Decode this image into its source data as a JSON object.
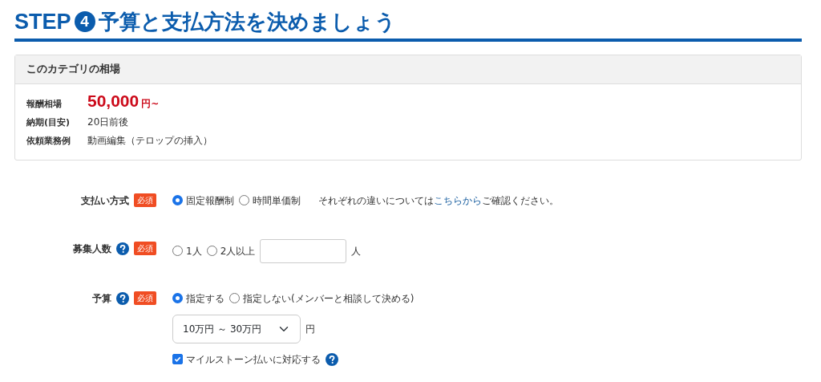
{
  "heading": {
    "prefix": "STEP",
    "step_number": "4",
    "title": "予算と支払方法を決めましょう"
  },
  "market": {
    "title": "このカテゴリの相場",
    "rows": [
      {
        "kind": "price",
        "label": "報酬相場",
        "value": "50,000",
        "unit": "円~"
      },
      {
        "kind": "text",
        "label": "納期(目安)",
        "value": "20日前後"
      },
      {
        "kind": "text",
        "label": "依頼業務例",
        "value": "動画編集（テロップの挿入）"
      }
    ]
  },
  "form": [
    {
      "label": "支払い方式",
      "help": false,
      "required": "必須",
      "radios": [
        {
          "label": "固定報酬制",
          "selected": true
        },
        {
          "label": "時間単価制",
          "selected": false
        }
      ],
      "note": {
        "before": "それぞれの違いについては",
        "link": "こちらから",
        "after": "ご確認ください。"
      }
    },
    {
      "label": "募集人数",
      "help": true,
      "required": "必須",
      "radios": [
        {
          "label": "1人",
          "selected": false
        },
        {
          "label": "2人以上",
          "selected": false
        }
      ],
      "input": {
        "unit": "人"
      }
    },
    {
      "label": "予算",
      "help": true,
      "required": "必須",
      "radios": [
        {
          "label": "指定する",
          "selected": true
        },
        {
          "label": "指定しない(メンバーと相談して決める)",
          "selected": false
        }
      ],
      "select": {
        "value": "10万円 ～ 30万円",
        "unit": "円"
      },
      "checkbox": {
        "label": "マイルストーン払いに対応する",
        "checked": true,
        "help": true
      }
    }
  ]
}
